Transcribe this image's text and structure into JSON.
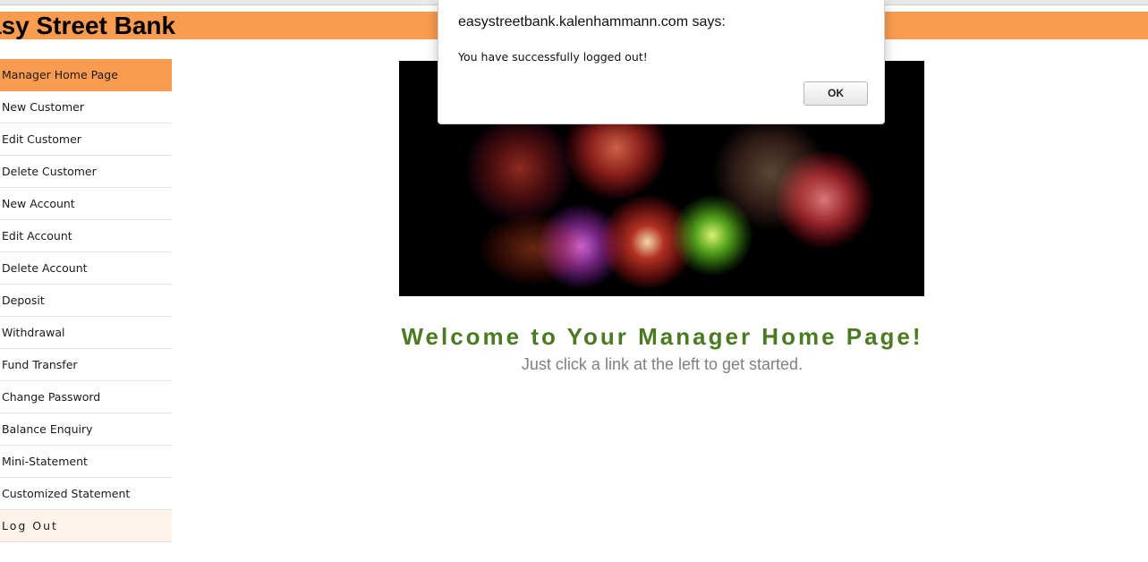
{
  "app": {
    "title": "asy Street Bank"
  },
  "sidebar": {
    "items": [
      {
        "label": "Manager Home Page"
      },
      {
        "label": "New Customer"
      },
      {
        "label": "Edit Customer"
      },
      {
        "label": "Delete Customer"
      },
      {
        "label": "New Account"
      },
      {
        "label": "Edit Account"
      },
      {
        "label": "Delete Account"
      },
      {
        "label": "Deposit"
      },
      {
        "label": "Withdrawal"
      },
      {
        "label": "Fund Transfer"
      },
      {
        "label": "Change Password"
      },
      {
        "label": "Balance Enquiry"
      },
      {
        "label": "Mini-Statement"
      },
      {
        "label": "Customized Statement"
      },
      {
        "label": "Log Out"
      }
    ]
  },
  "main": {
    "welcome": "Welcome to Your Manager Home Page!",
    "subtitle": "Just click a link at the left to get started."
  },
  "dialog": {
    "title": "easystreetbank.kalenhammann.com says:",
    "message": "You have successfully logged out!",
    "ok_label": "OK"
  },
  "colors": {
    "banner": "#fa9c50",
    "active_nav": "#fa9c50",
    "welcome_text": "#4a7a22",
    "subtitle_text": "#808080"
  }
}
